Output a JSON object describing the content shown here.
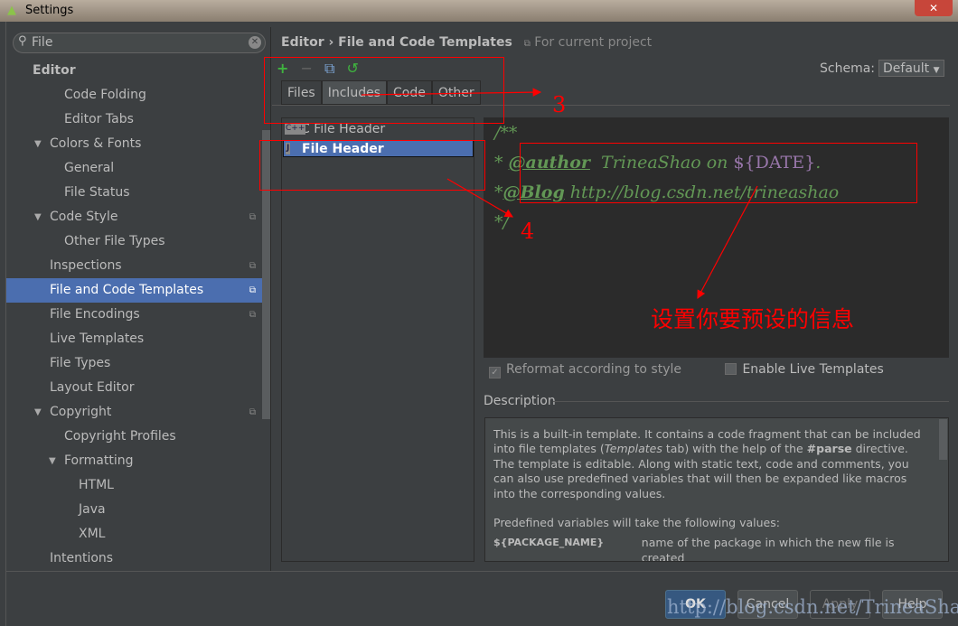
{
  "window": {
    "title": "Settings",
    "close": "✕"
  },
  "search": {
    "value": "File"
  },
  "sidebar": {
    "items": [
      {
        "label": "Editor",
        "level": 0,
        "bold": true
      },
      {
        "label": "Code Folding",
        "level": 2
      },
      {
        "label": "Editor Tabs",
        "level": 2
      },
      {
        "label": "Colors & Fonts",
        "level": 1,
        "expanded": true
      },
      {
        "label": "General",
        "level": 2
      },
      {
        "label": "File Status",
        "level": 2
      },
      {
        "label": "Code Style",
        "level": 1,
        "expanded": true,
        "project": true
      },
      {
        "label": "Other File Types",
        "level": 2
      },
      {
        "label": "Inspections",
        "level": 1,
        "project": true
      },
      {
        "label": "File and Code Templates",
        "level": 1,
        "project": true,
        "selected": true
      },
      {
        "label": "File Encodings",
        "level": 1,
        "project": true
      },
      {
        "label": "Live Templates",
        "level": 1
      },
      {
        "label": "File Types",
        "level": 1
      },
      {
        "label": "Layout Editor",
        "level": 1
      },
      {
        "label": "Copyright",
        "level": 1,
        "expanded": true,
        "project": true
      },
      {
        "label": "Copyright Profiles",
        "level": 2
      },
      {
        "label": "Formatting",
        "level": 2,
        "expanded": true
      },
      {
        "label": "HTML",
        "level": 3
      },
      {
        "label": "Java",
        "level": 3
      },
      {
        "label": "XML",
        "level": 3
      },
      {
        "label": "Intentions",
        "level": 1
      }
    ]
  },
  "breadcrumb": {
    "parent": "Editor",
    "sep": "›",
    "current": "File and Code Templates",
    "scope": "For current project"
  },
  "toolbar": {
    "add": "+",
    "remove": "−",
    "copy": "⧉",
    "reset": "↺"
  },
  "schema": {
    "label": "Schema:",
    "value": "Default"
  },
  "tabs": [
    {
      "label": "Files"
    },
    {
      "label": "Includes",
      "active": true
    },
    {
      "label": "Code"
    },
    {
      "label": "Other"
    }
  ],
  "templates": [
    {
      "label": "C File Header",
      "icon": "C++"
    },
    {
      "label": "File Header",
      "icon": "J",
      "selected": true
    }
  ],
  "editor": {
    "l1": "/**",
    "l2a": "* ",
    "l2tag": "@author",
    "l2b": "  TrineaShao on ",
    "l2var": "${DATE}",
    "l2c": ".",
    "l3a": "*",
    "l3tag": "@Blog",
    "l3b": " http://blog.csdn.net/trineashao",
    "l4": "*/"
  },
  "options": {
    "reformat": "Reformat according to style",
    "reformat_checked": true,
    "live": "Enable Live Templates",
    "live_checked": false
  },
  "description": {
    "label": "Description",
    "p1a": "This is a built-in template. It contains a code fragment that can be included into file templates (",
    "p1i": "Templates",
    "p1b": " tab) with the help of the ",
    "p1bold": "#parse",
    "p1c": " directive. The template is editable. Along with static text, code and comments, you can also use predefined variables that will then be expanded like macros into the corresponding values.",
    "p2": "Predefined variables will take the following values:",
    "var": "${PACKAGE_NAME}",
    "vardesc": "name of the package in which the new file is created"
  },
  "buttons": {
    "ok": "OK",
    "cancel": "Cancel",
    "apply": "Apply",
    "help": "Help"
  },
  "annotations": {
    "n3": "3",
    "n4": "4",
    "note": "设置你要预设的信息",
    "color": "#ff0000"
  },
  "watermark": "http://blog.csdn.net/TrineaShao"
}
